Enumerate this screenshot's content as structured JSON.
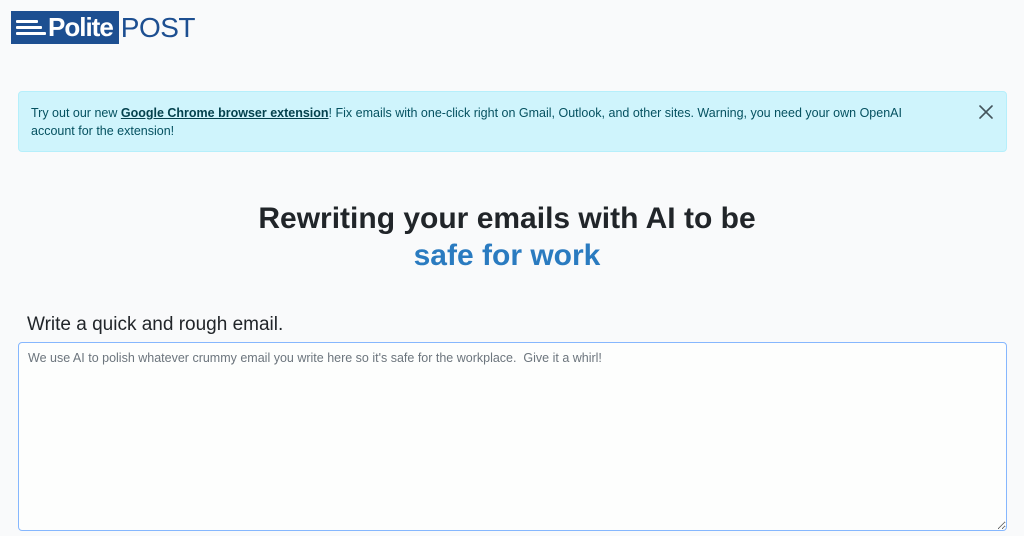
{
  "logo": {
    "word1": "Polite",
    "word2": "POST"
  },
  "alert": {
    "prefix": "Try out our new ",
    "link_text": "Google Chrome browser extension",
    "suffix": "! Fix emails with one-click right on Gmail, Outlook, and other sites. Warning, you need your own OpenAI account for the extension!",
    "close_icon": "close-icon"
  },
  "hero": {
    "line1": "Rewriting your emails with AI to be",
    "line2": "safe for work"
  },
  "form": {
    "label": "Write a quick and rough email.",
    "value": "",
    "placeholder": "We use AI to polish whatever crummy email you write here so it's safe for the workplace.  Give it a whirl!"
  },
  "colors": {
    "brand": "#1d4f91",
    "accent": "#2a7bc0",
    "alert_bg": "#cff4fc",
    "alert_text": "#055160"
  }
}
